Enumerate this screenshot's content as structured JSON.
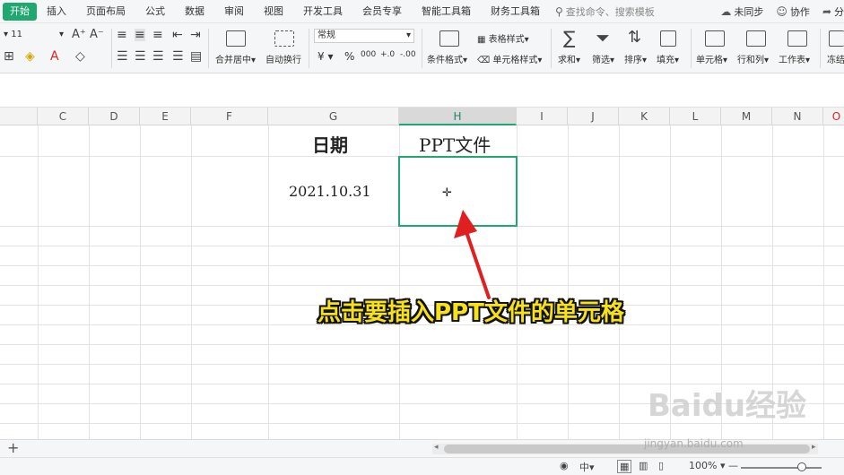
{
  "menu": {
    "tabs": [
      {
        "label": "开始",
        "active": true
      },
      {
        "label": "插入"
      },
      {
        "label": "页面布局"
      },
      {
        "label": "公式"
      },
      {
        "label": "数据"
      },
      {
        "label": "审阅"
      },
      {
        "label": "视图"
      },
      {
        "label": "开发工具"
      },
      {
        "label": "会员专享"
      },
      {
        "label": "智能工具箱"
      },
      {
        "label": "财务工具箱"
      }
    ],
    "search_placeholder": "查找命令、搜索模板",
    "sync_label": "未同步",
    "collab_label": "协作",
    "share_label": "分"
  },
  "ribbon": {
    "font_size": "11",
    "wrap_merge_label": "合并居中",
    "auto_wrap_label": "自动换行",
    "number_format": "常规",
    "currency_symbol": "¥",
    "percent_symbol": "%",
    "thousands_symbol": "000",
    "decimal_inc": "+.0",
    "decimal_dec": "-.00",
    "table_style_label": "表格样式",
    "cond_format_label": "条件格式",
    "cell_style_label": "单元格样式",
    "sum_label": "求和",
    "filter_label": "筛选",
    "sort_label": "排序",
    "fill_label": "填充",
    "cell_label": "单元格",
    "rowcol_label": "行和列",
    "worksheet_label": "工作表",
    "freeze_label": "冻结"
  },
  "grid": {
    "columns": [
      "C",
      "D",
      "E",
      "F",
      "G",
      "H",
      "I",
      "J",
      "K",
      "L",
      "M",
      "N",
      "O"
    ],
    "selected_column": "H",
    "header_g": "日期",
    "header_h": "PPT文件",
    "value_g": "2021.10.31"
  },
  "annotation": {
    "text": "点击要插入PPT文件的单元格",
    "color": "#f7e21a"
  },
  "tabbar": {
    "add_label": "+"
  },
  "status": {
    "zoom": "100%",
    "zoom_minus": "—"
  },
  "watermark": {
    "logo_text": "Baidu经验",
    "url": "jingyan.baidu.com"
  },
  "colors": {
    "accent": "#1fa870",
    "annotation_arrow": "#e02020"
  }
}
